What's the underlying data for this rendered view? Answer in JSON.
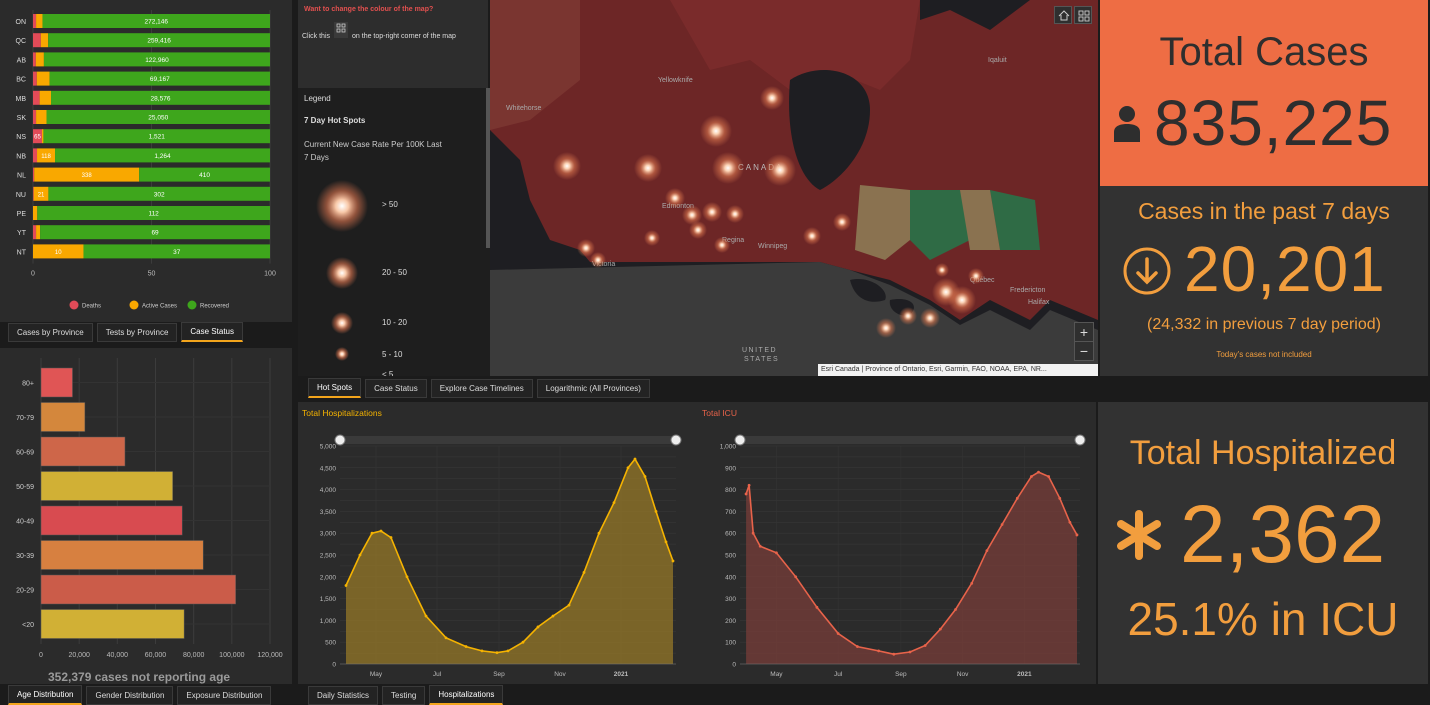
{
  "colors": {
    "deaths": "#e24b58",
    "active": "#f9a800",
    "recovered": "#3ea61c",
    "accent_orange": "#f29e3e",
    "card_red": "#ee6d44",
    "hosp_line": "#f5b301",
    "icu_line": "#e8634a"
  },
  "provinces": {
    "rows": [
      {
        "code": "ON",
        "deaths": 1.3,
        "active": 2.7,
        "recovered_label": "272,146",
        "active_label": "",
        "deaths_label": ""
      },
      {
        "code": "QC",
        "deaths": 3.3,
        "active": 3.1,
        "recovered_label": "259,416",
        "active_label": "",
        "deaths_label": ""
      },
      {
        "code": "AB",
        "deaths": 1.2,
        "active": 3.4,
        "recovered_label": "122,960",
        "active_label": "",
        "deaths_label": ""
      },
      {
        "code": "BC",
        "deaths": 1.6,
        "active": 5.4,
        "recovered_label": "69,167",
        "active_label": "",
        "deaths_label": ""
      },
      {
        "code": "MB",
        "deaths": 2.8,
        "active": 4.8,
        "recovered_label": "28,576",
        "active_label": "",
        "deaths_label": ""
      },
      {
        "code": "SK",
        "deaths": 1.3,
        "active": 4.4,
        "recovered_label": "25,050",
        "active_label": "",
        "deaths_label": ""
      },
      {
        "code": "NS",
        "deaths": 3.8,
        "active": 0.6,
        "recovered_label": "1,521",
        "active_label": "",
        "deaths_label": "65"
      },
      {
        "code": "NB",
        "deaths": 1.7,
        "active": 7.6,
        "recovered_label": "1,264",
        "active_label": "118",
        "deaths_label": ""
      },
      {
        "code": "NL",
        "deaths": 0.5,
        "active": 44.3,
        "recovered_label": "410",
        "active_label": "338",
        "deaths_label": ""
      },
      {
        "code": "NU",
        "deaths": 0.3,
        "active": 6.2,
        "recovered_label": "302",
        "active_label": "21",
        "deaths_label": ""
      },
      {
        "code": "PE",
        "deaths": 0,
        "active": 1.8,
        "recovered_label": "112",
        "active_label": "",
        "deaths_label": ""
      },
      {
        "code": "YT",
        "deaths": 1.3,
        "active": 1.7,
        "recovered_label": "69",
        "active_label": "",
        "deaths_label": ""
      },
      {
        "code": "NT",
        "deaths": 0,
        "active": 21.3,
        "recovered_label": "37",
        "active_label": "10",
        "deaths_label": ""
      }
    ],
    "ticks": [
      "0",
      "50",
      "100"
    ],
    "legend": [
      "Deaths",
      "Active Cases",
      "Recovered"
    ],
    "tabs": [
      "Cases by Province",
      "Tests by Province",
      "Case Status"
    ]
  },
  "age": {
    "groups": [
      {
        "label": "80+",
        "value": 16500,
        "color": "#e05555"
      },
      {
        "label": "70-79",
        "value": 23000,
        "color": "#d4873c"
      },
      {
        "label": "60-69",
        "value": 44000,
        "color": "#ce6649"
      },
      {
        "label": "50-59",
        "value": 69000,
        "color": "#d1b035"
      },
      {
        "label": "40-49",
        "value": 74000,
        "color": "#d84b50"
      },
      {
        "label": "30-39",
        "value": 85000,
        "color": "#d78040"
      },
      {
        "label": "20-29",
        "value": 102000,
        "color": "#cb5c49"
      },
      {
        "label": "<20",
        "value": 75000,
        "color": "#d1b035"
      }
    ],
    "ticks": [
      "0",
      "20,000",
      "40,000",
      "60,000",
      "80,000",
      "100,000",
      "120,000"
    ],
    "xmax": 120000,
    "note": "352,379 cases not reporting age",
    "tabs": [
      "Age Distribution",
      "Gender Distribution",
      "Exposure Distribution"
    ]
  },
  "map_info": {
    "title": "Want to change the colour of the map?",
    "instruction_pre": "Click this",
    "instruction_post": "on the top-right corner of the map",
    "legend_heading": "Legend",
    "legend_title": "7 Day Hot Spots",
    "legend_subtitle_1": "Current New Case Rate Per 100K Last",
    "legend_subtitle_2": "7 Days",
    "legend_items": [
      "> 50",
      "20 - 50",
      "10 - 20",
      "5 - 10",
      "< 5"
    ]
  },
  "map": {
    "labels": {
      "yellowknife": "Yellowknife",
      "whitehorse": "Whitehorse",
      "iqaluit": "Iqaluit",
      "canada": "CANADA",
      "edmonton": "Edmonton",
      "regina": "Regina",
      "winnipeg": "Winnipeg",
      "victoria": "Victoria",
      "quebec": "Québec",
      "fredericton": "Fredericton",
      "halifax": "Halifax",
      "united": "UNITED",
      "states": "STATES"
    },
    "attribution": "Esri Canada | Province of Ontario, Esri, Garmin, FAO, NOAA, EPA, NR...",
    "zoom_in": "+",
    "zoom_out": "−",
    "tabs": [
      "Hot Spots",
      "Case Status",
      "Explore Case Timelines",
      "Logarithmic (All Provinces)"
    ]
  },
  "total_cases": {
    "title": "Total Cases",
    "value": "835,225"
  },
  "weekly": {
    "title": "Cases in the past 7 days",
    "value": "20,201",
    "previous": "(24,332 in previous 7 day period)",
    "note": "Today's cases not included"
  },
  "hospitalized": {
    "title": "Total Hospitalized",
    "value": "2,362",
    "icu_pct": "25.1% in ICU"
  },
  "chart_data": [
    {
      "type": "line",
      "title": "Total Hospitalizations",
      "x": [
        "2020-04-01",
        "2020-04-15",
        "2020-04-27",
        "2020-05-06",
        "2020-05-16",
        "2020-06-01",
        "2020-06-20",
        "2020-07-10",
        "2020-07-30",
        "2020-08-15",
        "2020-08-30",
        "2020-09-10",
        "2020-09-25",
        "2020-10-10",
        "2020-10-25",
        "2020-11-10",
        "2020-11-25",
        "2020-12-10",
        "2020-12-25",
        "2021-01-08",
        "2021-01-15",
        "2021-01-25",
        "2021-02-05",
        "2021-02-15",
        "2021-02-22"
      ],
      "y": [
        1800,
        2500,
        3000,
        3050,
        2900,
        2000,
        1100,
        600,
        400,
        300,
        260,
        300,
        500,
        850,
        1100,
        1350,
        2100,
        3000,
        3700,
        4500,
        4700,
        4300,
        3500,
        2800,
        2362
      ],
      "ylim": [
        0,
        5000
      ],
      "yticks": [
        "0",
        "250",
        "500",
        "750",
        "1,000",
        "1,250",
        "1,500",
        "1,750",
        "2,000",
        "2,250",
        "2,500",
        "2,750",
        "3,000",
        "3,250",
        "3,500",
        "3,750",
        "4,000",
        "4,250",
        "4,500",
        "4,750",
        "5,000"
      ],
      "xticks": [
        "May",
        "Jul",
        "Sep",
        "Nov",
        "2021"
      ]
    },
    {
      "type": "line",
      "title": "Total ICU",
      "x": [
        "2020-04-01",
        "2020-04-04",
        "2020-04-08",
        "2020-04-15",
        "2020-05-01",
        "2020-05-20",
        "2020-06-10",
        "2020-07-01",
        "2020-07-20",
        "2020-08-10",
        "2020-08-25",
        "2020-09-10",
        "2020-09-25",
        "2020-10-10",
        "2020-10-25",
        "2020-11-10",
        "2020-11-25",
        "2020-12-10",
        "2020-12-25",
        "2021-01-08",
        "2021-01-15",
        "2021-01-25",
        "2021-02-05",
        "2021-02-15",
        "2021-02-22"
      ],
      "y": [
        780,
        820,
        600,
        540,
        510,
        400,
        260,
        140,
        80,
        60,
        45,
        55,
        85,
        160,
        250,
        370,
        520,
        640,
        760,
        860,
        880,
        860,
        760,
        650,
        592
      ],
      "ylim": [
        0,
        1000
      ],
      "yticks": [
        "0",
        "50",
        "100",
        "150",
        "200",
        "250",
        "300",
        "350",
        "400",
        "450",
        "500",
        "550",
        "600",
        "650",
        "700",
        "750",
        "800",
        "850",
        "900",
        "950",
        "1,000"
      ],
      "xticks": [
        "May",
        "Jul",
        "Sep",
        "Nov",
        "2021"
      ]
    }
  ],
  "bottom_tabs": [
    "Daily Statistics",
    "Testing",
    "Hospitalizations"
  ]
}
